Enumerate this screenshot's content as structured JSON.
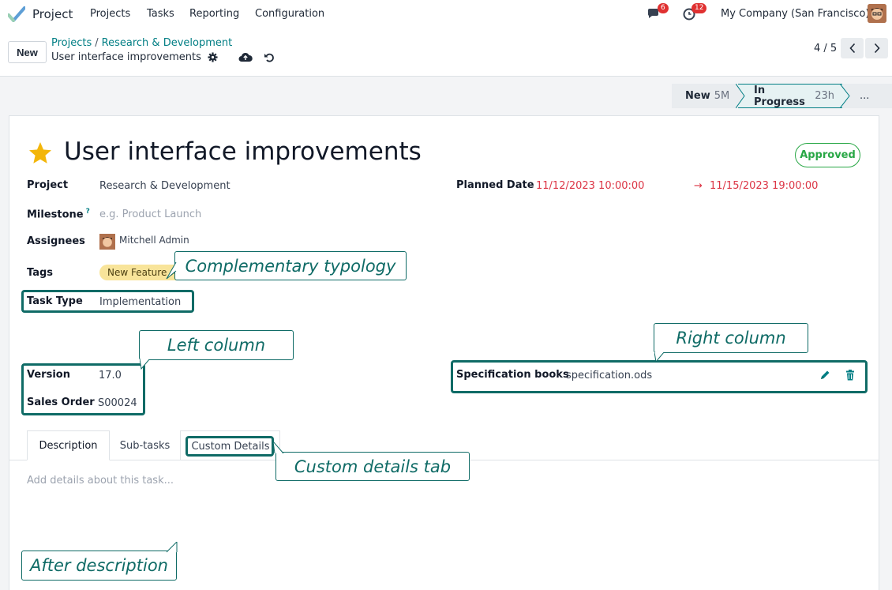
{
  "navbar": {
    "app_name": "Project",
    "menu": [
      "Projects",
      "Tasks",
      "Reporting",
      "Configuration"
    ],
    "messages_count": "6",
    "activities_count": "12",
    "company": "My Company (San Francisco)"
  },
  "control": {
    "new_label": "New",
    "breadcrumb": [
      "Projects",
      "Research & Development"
    ],
    "record_name": "User interface improvements",
    "pager": "4 / 5"
  },
  "statusbar": {
    "stages": [
      {
        "name": "New",
        "duration": "5M"
      },
      {
        "name": "In Progress",
        "duration": "23h"
      },
      {
        "name": "...",
        "duration": ""
      }
    ]
  },
  "task": {
    "title": "User interface improvements",
    "status": "Approved",
    "project_label": "Project",
    "project_value": "Research & Development",
    "milestone_label": "Milestone",
    "milestone_help": "?",
    "milestone_placeholder": "e.g. Product Launch",
    "assignees_label": "Assignees",
    "assignee": "Mitchell Admin",
    "tags_label": "Tags",
    "tag": "New Feature ×",
    "task_type_label": "Task Type",
    "task_type_value": "Implementation",
    "planned_label": "Planned Date",
    "planned_start": "11/12/2023 10:00:00",
    "planned_arrow": "→",
    "planned_end": "11/15/2023 19:00:00",
    "version_label": "Version",
    "version_value": "17.0",
    "sales_order_label": "Sales Order",
    "sales_order_value": "S00024",
    "spec_label": "Specification books",
    "spec_value": "specification.ods"
  },
  "tabs": [
    "Description",
    "Sub-tasks",
    "Custom Details"
  ],
  "description_placeholder": "Add details about this task...",
  "callouts": {
    "complementary": "Complementary typology",
    "left_column": "Left column",
    "right_column": "Right column",
    "custom_tab": "Custom details tab",
    "after_description": "After description"
  },
  "colors": {
    "accent": "#017e84",
    "annotation": "#0f6b66",
    "danger": "#dc3545",
    "success": "#28a745",
    "star": "#f3b60a",
    "tag": "#f8e49a"
  }
}
